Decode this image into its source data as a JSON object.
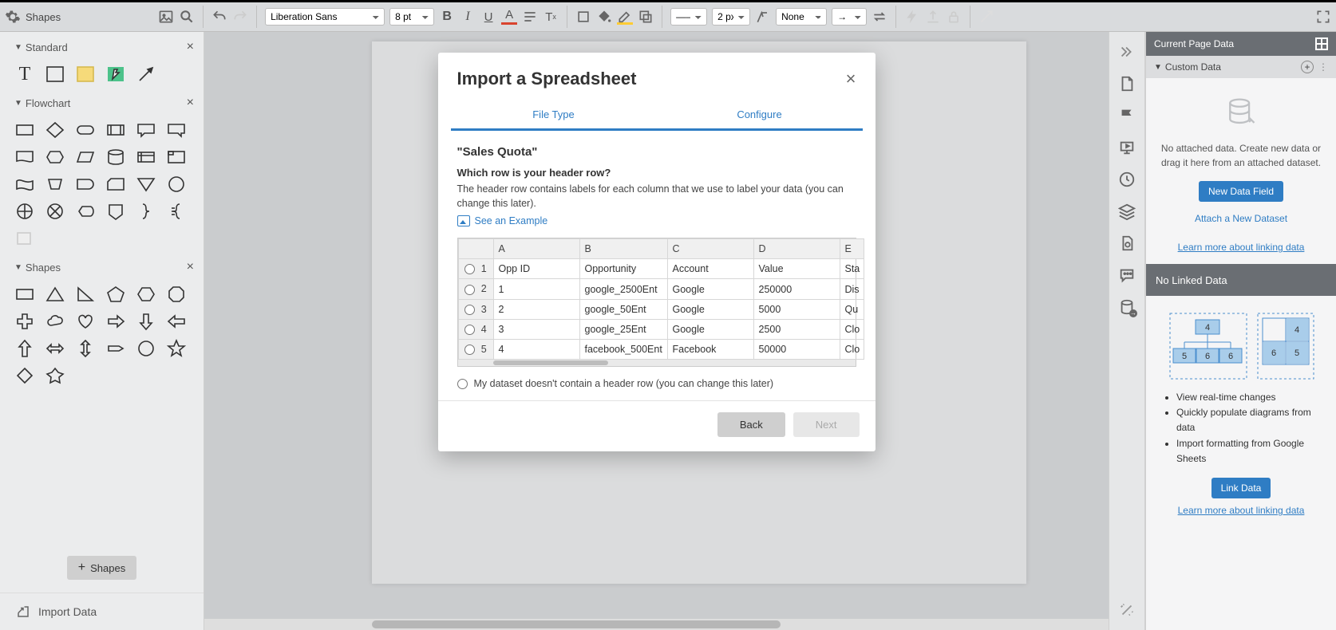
{
  "toolbar": {
    "shapes_label": "Shapes",
    "font": "Liberation Sans",
    "font_size": "8 pt",
    "line_style": "———",
    "stroke_width": "2 px",
    "fill_option": "None"
  },
  "left_panel": {
    "sections": {
      "standard": "Standard",
      "flowchart": "Flowchart",
      "shapes": "Shapes"
    },
    "shapes_button": "Shapes",
    "import_data": "Import Data"
  },
  "modal": {
    "title": "Import a Spreadsheet",
    "tabs": {
      "file_type": "File Type",
      "configure": "Configure"
    },
    "sheet_name": "\"Sales Quota\"",
    "question": "Which row is your header row?",
    "desc": "The header row contains labels for each column that we use to label your data (you can change this later).",
    "see_example": "See an Example",
    "columns": [
      "A",
      "B",
      "C",
      "D",
      "E"
    ],
    "rows": [
      {
        "n": "1",
        "cells": [
          "Opp ID",
          "Opportunity",
          "Account",
          "Value",
          "Sta"
        ]
      },
      {
        "n": "2",
        "cells": [
          "1",
          "google_2500Ent",
          "Google",
          "250000",
          "Dis"
        ]
      },
      {
        "n": "3",
        "cells": [
          "2",
          "google_50Ent",
          "Google",
          "5000",
          "Qu"
        ]
      },
      {
        "n": "4",
        "cells": [
          "3",
          "google_25Ent",
          "Google",
          "2500",
          "Clo"
        ]
      },
      {
        "n": "5",
        "cells": [
          "4",
          "facebook_500Ent",
          "Facebook",
          "50000",
          "Clo"
        ]
      }
    ],
    "no_header": "My dataset doesn't contain a header row (you can change this later)",
    "back": "Back",
    "next": "Next"
  },
  "right_panel": {
    "header": "Current Page Data",
    "custom_data": "Custom Data",
    "no_attached": "No attached data. Create new data or drag it here from an attached dataset.",
    "new_field": "New Data Field",
    "attach": "Attach a New Dataset",
    "learn_more": "Learn more about linking data",
    "no_linked": "No Linked Data",
    "bullets": {
      "b1": "View real-time changes",
      "b2": "Quickly populate diagrams from data",
      "b3": "Import formatting from Google Sheets"
    },
    "diagram_labels": {
      "top": "4",
      "l": "5",
      "m": "6",
      "r": "6",
      "g1": "4",
      "g2": "5",
      "g3": "6"
    },
    "link_data": "Link Data"
  }
}
